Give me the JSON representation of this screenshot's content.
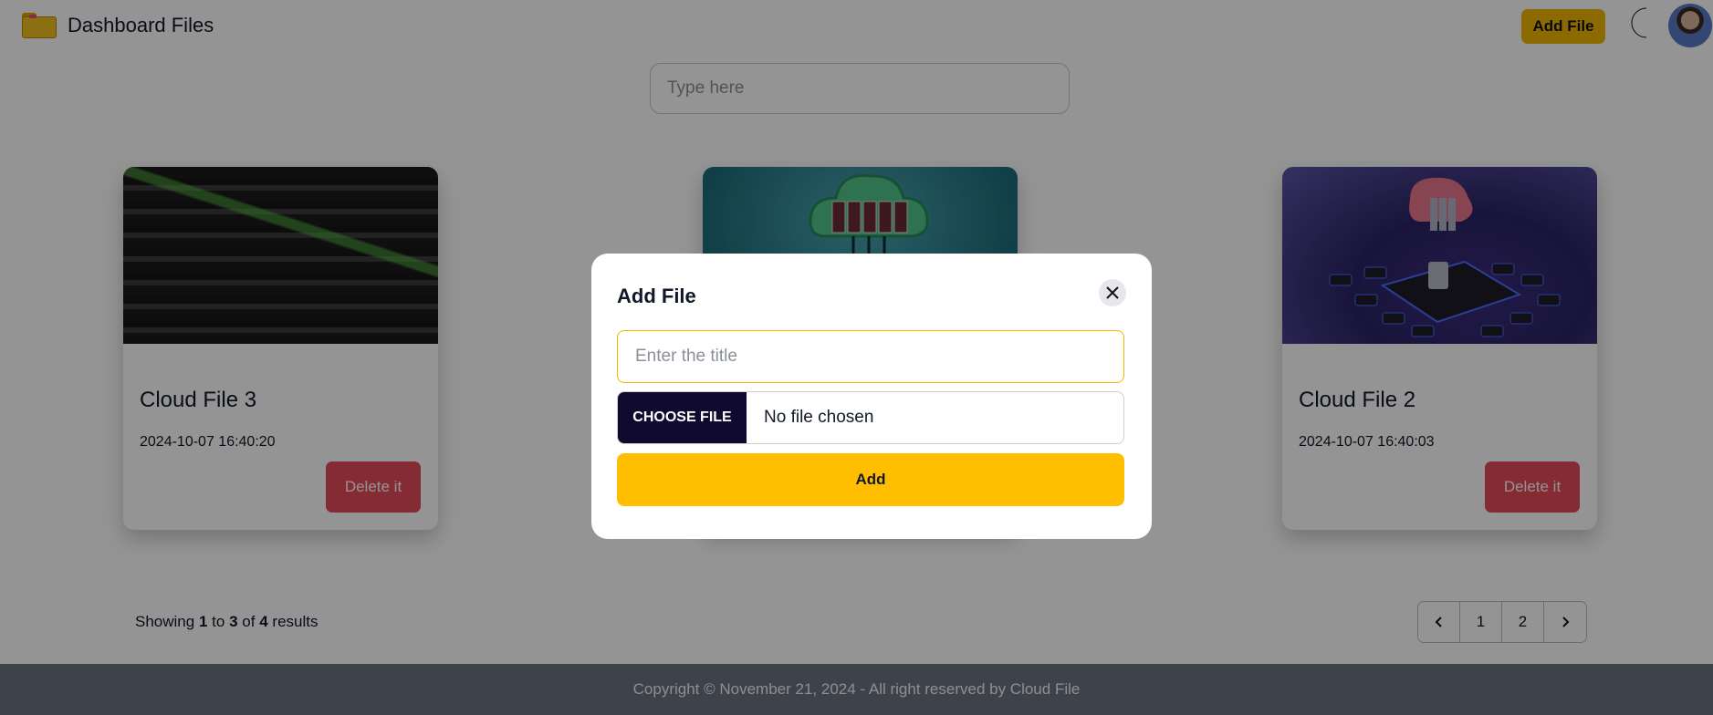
{
  "header": {
    "title": "Dashboard Files",
    "add_file_label": "Add File",
    "brand_icon": "folder-icon",
    "theme_icon": "moon-icon"
  },
  "search": {
    "placeholder": "Type here"
  },
  "cards": [
    {
      "title": "Cloud File 3",
      "date": "2024-10-07 16:40:20",
      "delete_label": "Delete it"
    },
    {
      "title": "",
      "date": "",
      "delete_label": ""
    },
    {
      "title": "Cloud File 2",
      "date": "2024-10-07 16:40:03",
      "delete_label": "Delete it"
    }
  ],
  "results": {
    "prefix": "Showing",
    "from": "1",
    "to_word": "to",
    "to": "3",
    "of_word": "of",
    "total": "4",
    "suffix": "results"
  },
  "pagination": {
    "prev_icon": "chevron-left-icon",
    "pages": [
      "1",
      "2"
    ],
    "next_icon": "chevron-right-icon"
  },
  "footer": {
    "text": "Copyright © November 21, 2024 - All right reserved by Cloud File"
  },
  "modal": {
    "title": "Add File",
    "title_placeholder": "Enter the title",
    "choose_file_label": "CHOOSE FILE",
    "no_file_text": "No file chosen",
    "add_label": "Add",
    "close_icon": "close-icon"
  },
  "colors": {
    "accent": "#ffbf00",
    "danger": "#e44b5a",
    "choose_btn": "#0f0a2e",
    "footer": "#6b7280"
  }
}
